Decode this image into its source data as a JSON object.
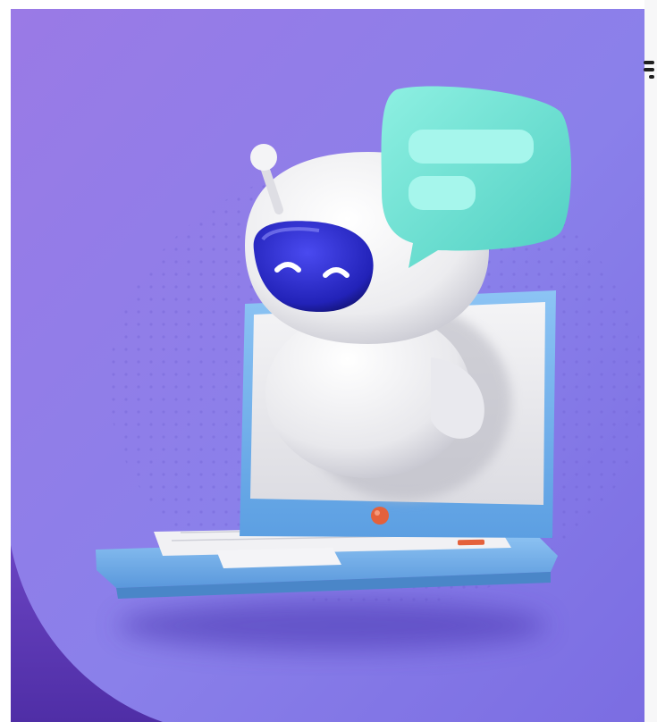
{
  "image": {
    "subject": "robot-emerging-from-laptop",
    "icons": [
      "robot-icon",
      "chat-bubble-icon",
      "laptop-icon"
    ],
    "colors": {
      "background_purple": "#8a74e8",
      "background_dark_purple": "#5a36b4",
      "robot_white": "#f2f2f4",
      "visor_blue": "#2f2fd0",
      "chat_bubble_teal": "#6fe4d6",
      "laptop_blue": "#77b4ee",
      "power_button_orange": "#e4613b"
    }
  }
}
